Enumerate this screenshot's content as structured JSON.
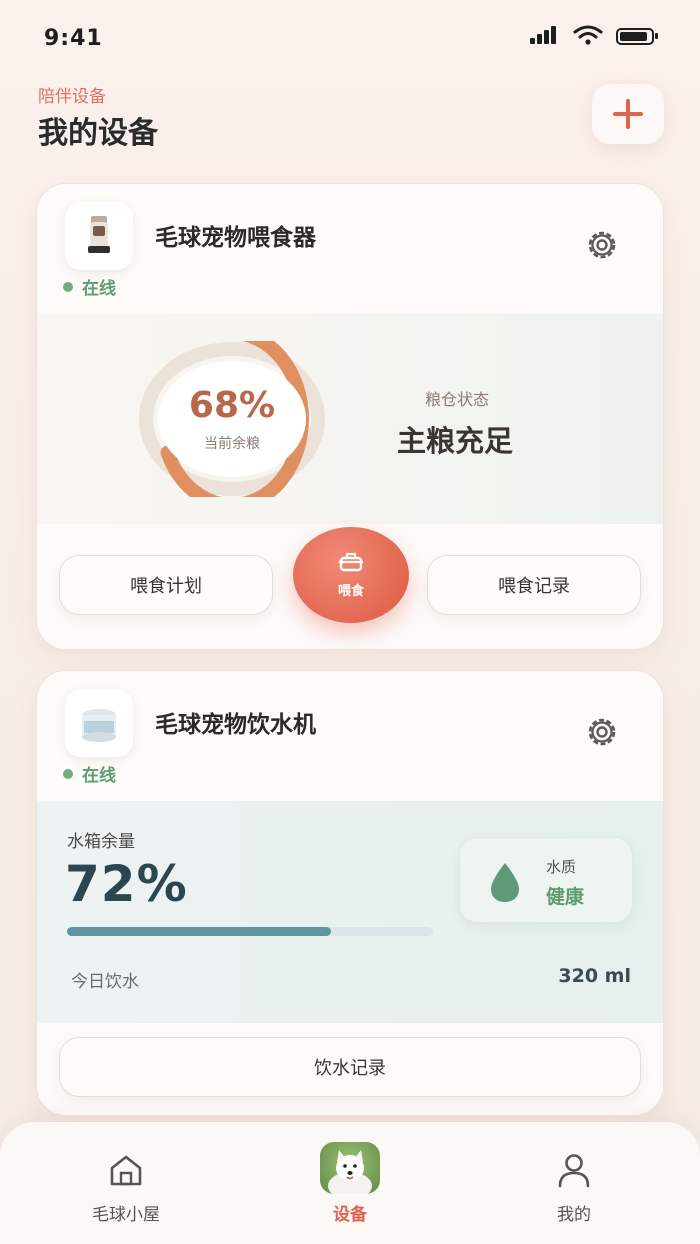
{
  "status_bar": {
    "time": "9:41"
  },
  "header": {
    "subtitle": "陪伴设备",
    "title": "我的设备"
  },
  "feeder": {
    "name": "毛球宠物喂食器",
    "status": "在线",
    "food_percent": "68%",
    "food_fraction": 0.68,
    "food_label": "当前余粮",
    "bin_label": "粮仓状态",
    "bin_value": "主粮充足",
    "plan_button": "喂食计划",
    "feed_button": "喂食",
    "record_button": "喂食记录"
  },
  "fountain": {
    "name": "毛球宠物饮水机",
    "status": "在线",
    "tank_label": "水箱余量",
    "tank_percent": "72%",
    "tank_fraction": 0.72,
    "quality_label": "水质",
    "quality_value": "健康",
    "today_label": "今日饮水",
    "today_value": "320 ml",
    "record_button": "饮水记录"
  },
  "bottom_nav": {
    "items": [
      {
        "label": "毛球小屋",
        "icon": "home-icon",
        "active": false
      },
      {
        "label": "设备",
        "icon": "pet-avatar",
        "active": true
      },
      {
        "label": "我的",
        "icon": "person-icon",
        "active": false
      }
    ]
  },
  "colors": {
    "accent": "#e0624f",
    "online": "#6fae83",
    "ring": "#e09060",
    "water_bar": "#5f95a0"
  }
}
